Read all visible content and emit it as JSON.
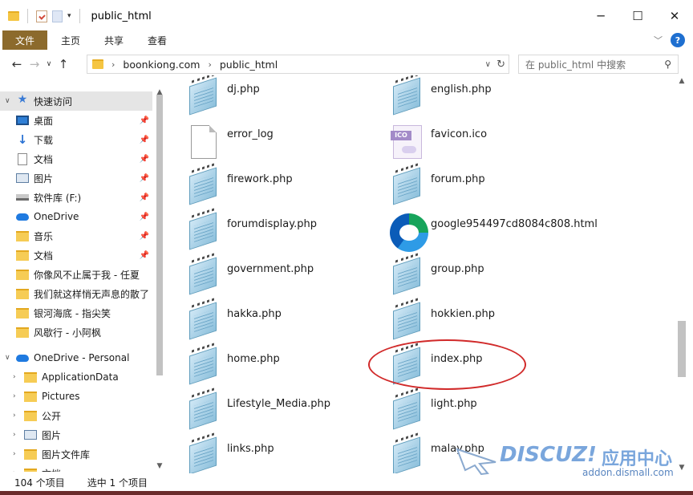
{
  "window": {
    "title": "public_html",
    "controls": {
      "minimize": "─",
      "maximize": "☐",
      "close": "✕"
    }
  },
  "ribbon": {
    "file_tab": "文件",
    "tabs": [
      "主页",
      "共享",
      "查看"
    ]
  },
  "address": {
    "crumbs": [
      "boonkiong.com",
      "public_html"
    ],
    "search_placeholder": "在 public_html 中搜索"
  },
  "nav": {
    "quick_access": "快速访问",
    "items": [
      {
        "label": "桌面",
        "icon": "desktop-icon",
        "pinned": true
      },
      {
        "label": "下载",
        "icon": "download-icon",
        "pinned": true
      },
      {
        "label": "文档",
        "icon": "document-icon",
        "pinned": true
      },
      {
        "label": "图片",
        "icon": "pictures-icon",
        "pinned": true
      },
      {
        "label": "软件库 (F:)",
        "icon": "drive-icon",
        "pinned": true
      },
      {
        "label": "OneDrive",
        "icon": "onedrive-icon",
        "pinned": true
      },
      {
        "label": "音乐",
        "icon": "folder-icon",
        "pinned": true
      },
      {
        "label": "文档",
        "icon": "folder-icon",
        "pinned": true
      },
      {
        "label": "你像风不止属于我 - 任夏",
        "icon": "folder-icon",
        "pinned": false
      },
      {
        "label": "我们就这样悄无声息的散了",
        "icon": "folder-icon",
        "pinned": false
      },
      {
        "label": "银河海底 - 指尖笑",
        "icon": "folder-icon",
        "pinned": false
      },
      {
        "label": "风歇行 - 小阿枫",
        "icon": "folder-icon",
        "pinned": false
      }
    ],
    "onedrive_personal": "OneDrive - Personal",
    "onedrive_items": [
      {
        "label": "ApplicationData",
        "icon": "folder-icon"
      },
      {
        "label": "Pictures",
        "icon": "folder-icon"
      },
      {
        "label": "公开",
        "icon": "folder-icon"
      },
      {
        "label": "图片",
        "icon": "pictures-icon"
      },
      {
        "label": "图片文件库",
        "icon": "folder-icon"
      },
      {
        "label": "文档",
        "icon": "folder-icon"
      }
    ]
  },
  "files": [
    {
      "name": "dj.php",
      "type": "notepad"
    },
    {
      "name": "english.php",
      "type": "notepad"
    },
    {
      "name": "error_log",
      "type": "blank"
    },
    {
      "name": "favicon.ico",
      "type": "ico"
    },
    {
      "name": "firework.php",
      "type": "notepad"
    },
    {
      "name": "forum.php",
      "type": "notepad"
    },
    {
      "name": "forumdisplay.php",
      "type": "notepad"
    },
    {
      "name": "google954497cd8084c808.html",
      "type": "edge"
    },
    {
      "name": "government.php",
      "type": "notepad"
    },
    {
      "name": "group.php",
      "type": "notepad"
    },
    {
      "name": "hakka.php",
      "type": "notepad"
    },
    {
      "name": "hokkien.php",
      "type": "notepad"
    },
    {
      "name": "home.php",
      "type": "notepad"
    },
    {
      "name": "index.php",
      "type": "notepad"
    },
    {
      "name": "Lifestyle_Media.php",
      "type": "notepad"
    },
    {
      "name": "light.php",
      "type": "notepad"
    },
    {
      "name": "links.php",
      "type": "notepad"
    },
    {
      "name": "malay.php",
      "type": "notepad"
    }
  ],
  "ico_tag": "ICO",
  "status": {
    "item_count": "104 个项目",
    "selected": "选中 1 个项目"
  },
  "watermark": {
    "brand": "DISCUZ!",
    "cn": "应用中心",
    "url": "addon.dismall.com"
  },
  "colors": {
    "file_tab": "#8c6a2c",
    "selection": "#cce8ff",
    "circle": "#d12a2a",
    "watermark": "#7aa6dc"
  }
}
